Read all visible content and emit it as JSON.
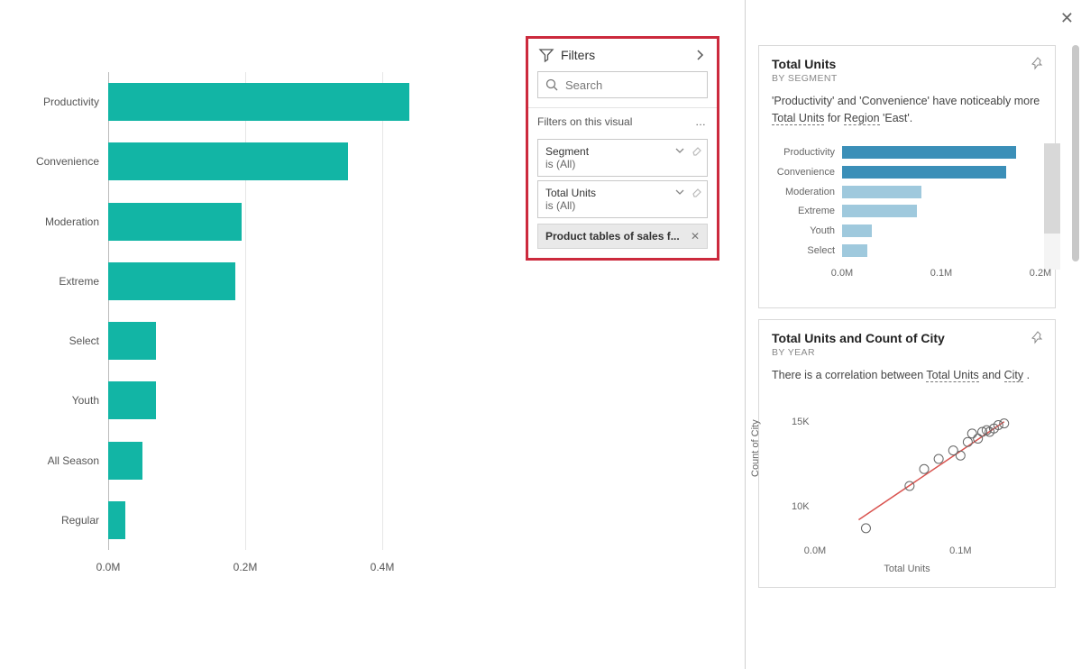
{
  "filters_pane": {
    "title": "Filters",
    "search_placeholder": "Search",
    "section_label": "Filters on this visual",
    "cards": [
      {
        "field": "Segment",
        "summary": "is (All)"
      },
      {
        "field": "Total Units",
        "summary": "is (All)"
      }
    ],
    "chip_label": "Product tables of sales f..."
  },
  "side": {
    "card1": {
      "title": "Total Units",
      "subtitle": "BY SEGMENT",
      "insight_parts": {
        "p1": "'Productivity' and 'Convenience' have noticeably more ",
        "u1": "Total Units",
        "p2": " for ",
        "u2": "Region",
        "p3": " 'East'."
      }
    },
    "card2": {
      "title": "Total Units and Count of City",
      "subtitle": "BY YEAR",
      "insight_parts": {
        "p1": "There is a correlation between ",
        "u1": "Total Units",
        "p2": " and ",
        "u2": "City",
        "p3": " ."
      }
    }
  },
  "chart_data": [
    {
      "id": "main_bars",
      "type": "bar",
      "orientation": "horizontal",
      "categories": [
        "Productivity",
        "Convenience",
        "Moderation",
        "Extreme",
        "Select",
        "Youth",
        "All Season",
        "Regular"
      ],
      "values": [
        0.44,
        0.35,
        0.195,
        0.185,
        0.07,
        0.07,
        0.05,
        0.025
      ],
      "xlabel": "",
      "ylabel": "",
      "xticks": [
        "0.0M",
        "0.2M",
        "0.4M"
      ],
      "xlim": [
        0,
        0.5
      ],
      "bar_color": "#12B5A5"
    },
    {
      "id": "segment_mini_bars",
      "type": "bar",
      "orientation": "horizontal",
      "title": "Total Units by Segment",
      "categories": [
        "Productivity",
        "Convenience",
        "Moderation",
        "Extreme",
        "Youth",
        "Select"
      ],
      "values": [
        0.175,
        0.165,
        0.08,
        0.075,
        0.03,
        0.025
      ],
      "xticks": [
        "0.0M",
        "0.1M",
        "0.2M"
      ],
      "xlim": [
        0,
        0.2
      ],
      "colors": [
        "#3b8fb8",
        "#3b8fb8",
        "#9fc9dd",
        "#9fc9dd",
        "#9fc9dd",
        "#9fc9dd"
      ]
    },
    {
      "id": "scatter_year",
      "type": "scatter",
      "title": "Total Units and Count of City by Year",
      "xlabel": "Total Units",
      "ylabel": "Count of City",
      "xlim": [
        0,
        0.15
      ],
      "ylim": [
        8,
        16
      ],
      "xticks": [
        "0.0M",
        "0.1M"
      ],
      "yticks": [
        "10K",
        "15K"
      ],
      "trend": {
        "x1": 0.03,
        "y1": 9.2,
        "x2": 0.13,
        "y2": 15.0,
        "color": "#d9534f"
      },
      "points": [
        {
          "x": 0.035,
          "y": 8.7
        },
        {
          "x": 0.065,
          "y": 11.2
        },
        {
          "x": 0.075,
          "y": 12.2
        },
        {
          "x": 0.085,
          "y": 12.8
        },
        {
          "x": 0.095,
          "y": 13.3
        },
        {
          "x": 0.1,
          "y": 13.0
        },
        {
          "x": 0.105,
          "y": 13.8
        },
        {
          "x": 0.108,
          "y": 14.3
        },
        {
          "x": 0.112,
          "y": 14.0
        },
        {
          "x": 0.115,
          "y": 14.4
        },
        {
          "x": 0.118,
          "y": 14.5
        },
        {
          "x": 0.12,
          "y": 14.4
        },
        {
          "x": 0.123,
          "y": 14.6
        },
        {
          "x": 0.126,
          "y": 14.8
        },
        {
          "x": 0.13,
          "y": 14.9
        }
      ]
    }
  ]
}
